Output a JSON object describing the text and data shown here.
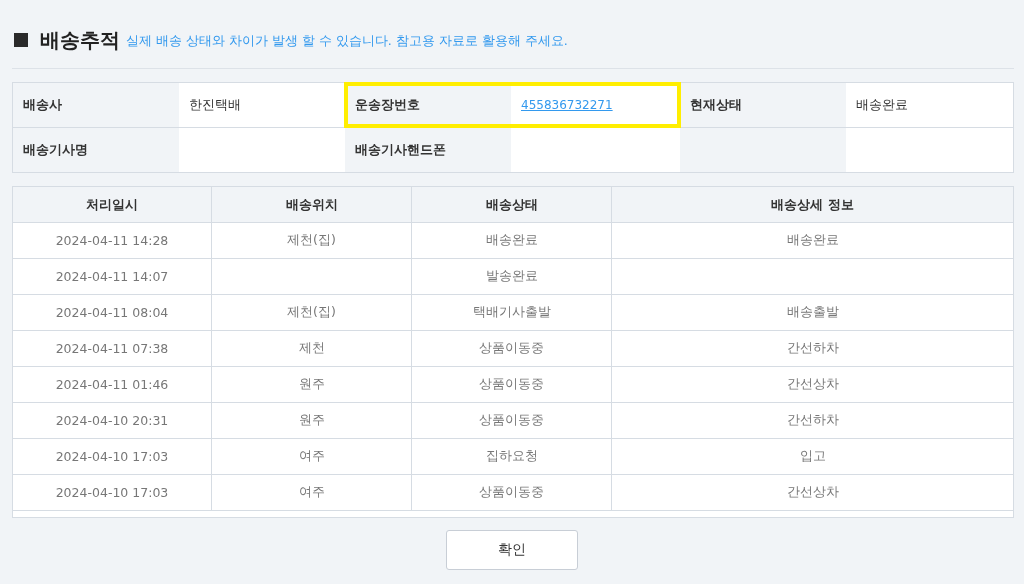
{
  "header": {
    "title": "배송추적",
    "notice": "실제 배송 상태와 차이가 발생 할 수 있습니다. 참고용 자료로 활용해 주세요."
  },
  "info": [
    [
      {
        "label": "배송사",
        "value": "한진택배",
        "kind": "text",
        "highlighted": false
      },
      {
        "label": "운송장번호",
        "value": "455836732271",
        "kind": "link",
        "highlighted": true
      },
      {
        "label": "현재상태",
        "value": "배송완료",
        "kind": "text",
        "highlighted": false
      }
    ],
    [
      {
        "label": "배송기사명",
        "highlighted": false
      },
      {
        "label": "배송기사핸드폰",
        "highlighted": false
      }
    ]
  ],
  "history": {
    "columns": [
      "처리일시",
      "배송위치",
      "배송상태",
      "배송상세 정보"
    ],
    "rows": [
      [
        "2024-04-11 14:28",
        "제천(집)",
        "배송완료",
        "배송완료"
      ],
      [
        "2024-04-11 14:07",
        "",
        "발송완료",
        ""
      ],
      [
        "2024-04-11 08:04",
        "제천(집)",
        "택배기사출발",
        "배송출발"
      ],
      [
        "2024-04-11 07:38",
        "제천",
        "상품이동중",
        "간선하차"
      ],
      [
        "2024-04-11 01:46",
        "원주",
        "상품이동중",
        "간선상차"
      ],
      [
        "2024-04-10 20:31",
        "원주",
        "상품이동중",
        "간선하차"
      ],
      [
        "2024-04-10 17:03",
        "여주",
        "집하요청",
        "입고"
      ],
      [
        "2024-04-10 17:03",
        "여주",
        "상품이동중",
        "간선상차"
      ]
    ]
  },
  "confirm_button": "확인"
}
